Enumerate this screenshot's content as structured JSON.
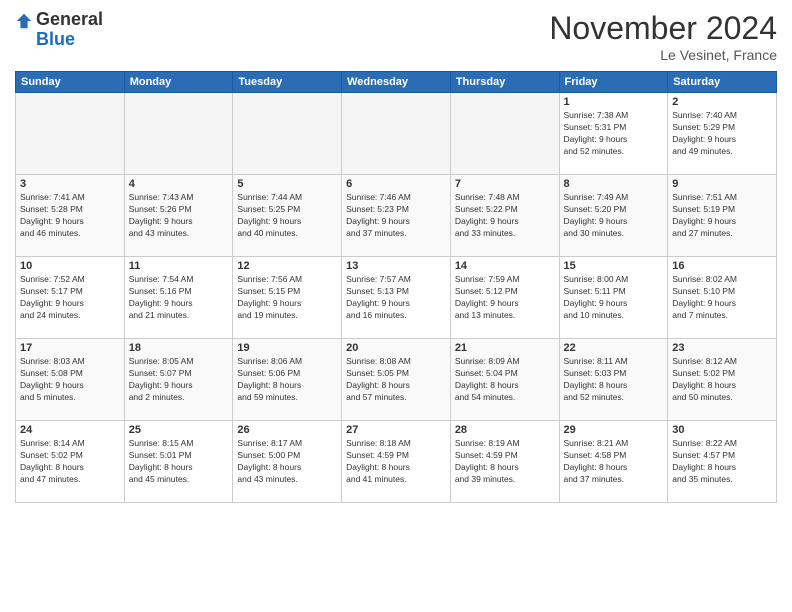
{
  "header": {
    "logo_general": "General",
    "logo_blue": "Blue",
    "month_title": "November 2024",
    "location": "Le Vesinet, France"
  },
  "weekdays": [
    "Sunday",
    "Monday",
    "Tuesday",
    "Wednesday",
    "Thursday",
    "Friday",
    "Saturday"
  ],
  "weeks": [
    [
      {
        "day": "",
        "info": ""
      },
      {
        "day": "",
        "info": ""
      },
      {
        "day": "",
        "info": ""
      },
      {
        "day": "",
        "info": ""
      },
      {
        "day": "",
        "info": ""
      },
      {
        "day": "1",
        "info": "Sunrise: 7:38 AM\nSunset: 5:31 PM\nDaylight: 9 hours\nand 52 minutes."
      },
      {
        "day": "2",
        "info": "Sunrise: 7:40 AM\nSunset: 5:29 PM\nDaylight: 9 hours\nand 49 minutes."
      }
    ],
    [
      {
        "day": "3",
        "info": "Sunrise: 7:41 AM\nSunset: 5:28 PM\nDaylight: 9 hours\nand 46 minutes."
      },
      {
        "day": "4",
        "info": "Sunrise: 7:43 AM\nSunset: 5:26 PM\nDaylight: 9 hours\nand 43 minutes."
      },
      {
        "day": "5",
        "info": "Sunrise: 7:44 AM\nSunset: 5:25 PM\nDaylight: 9 hours\nand 40 minutes."
      },
      {
        "day": "6",
        "info": "Sunrise: 7:46 AM\nSunset: 5:23 PM\nDaylight: 9 hours\nand 37 minutes."
      },
      {
        "day": "7",
        "info": "Sunrise: 7:48 AM\nSunset: 5:22 PM\nDaylight: 9 hours\nand 33 minutes."
      },
      {
        "day": "8",
        "info": "Sunrise: 7:49 AM\nSunset: 5:20 PM\nDaylight: 9 hours\nand 30 minutes."
      },
      {
        "day": "9",
        "info": "Sunrise: 7:51 AM\nSunset: 5:19 PM\nDaylight: 9 hours\nand 27 minutes."
      }
    ],
    [
      {
        "day": "10",
        "info": "Sunrise: 7:52 AM\nSunset: 5:17 PM\nDaylight: 9 hours\nand 24 minutes."
      },
      {
        "day": "11",
        "info": "Sunrise: 7:54 AM\nSunset: 5:16 PM\nDaylight: 9 hours\nand 21 minutes."
      },
      {
        "day": "12",
        "info": "Sunrise: 7:56 AM\nSunset: 5:15 PM\nDaylight: 9 hours\nand 19 minutes."
      },
      {
        "day": "13",
        "info": "Sunrise: 7:57 AM\nSunset: 5:13 PM\nDaylight: 9 hours\nand 16 minutes."
      },
      {
        "day": "14",
        "info": "Sunrise: 7:59 AM\nSunset: 5:12 PM\nDaylight: 9 hours\nand 13 minutes."
      },
      {
        "day": "15",
        "info": "Sunrise: 8:00 AM\nSunset: 5:11 PM\nDaylight: 9 hours\nand 10 minutes."
      },
      {
        "day": "16",
        "info": "Sunrise: 8:02 AM\nSunset: 5:10 PM\nDaylight: 9 hours\nand 7 minutes."
      }
    ],
    [
      {
        "day": "17",
        "info": "Sunrise: 8:03 AM\nSunset: 5:08 PM\nDaylight: 9 hours\nand 5 minutes."
      },
      {
        "day": "18",
        "info": "Sunrise: 8:05 AM\nSunset: 5:07 PM\nDaylight: 9 hours\nand 2 minutes."
      },
      {
        "day": "19",
        "info": "Sunrise: 8:06 AM\nSunset: 5:06 PM\nDaylight: 8 hours\nand 59 minutes."
      },
      {
        "day": "20",
        "info": "Sunrise: 8:08 AM\nSunset: 5:05 PM\nDaylight: 8 hours\nand 57 minutes."
      },
      {
        "day": "21",
        "info": "Sunrise: 8:09 AM\nSunset: 5:04 PM\nDaylight: 8 hours\nand 54 minutes."
      },
      {
        "day": "22",
        "info": "Sunrise: 8:11 AM\nSunset: 5:03 PM\nDaylight: 8 hours\nand 52 minutes."
      },
      {
        "day": "23",
        "info": "Sunrise: 8:12 AM\nSunset: 5:02 PM\nDaylight: 8 hours\nand 50 minutes."
      }
    ],
    [
      {
        "day": "24",
        "info": "Sunrise: 8:14 AM\nSunset: 5:02 PM\nDaylight: 8 hours\nand 47 minutes."
      },
      {
        "day": "25",
        "info": "Sunrise: 8:15 AM\nSunset: 5:01 PM\nDaylight: 8 hours\nand 45 minutes."
      },
      {
        "day": "26",
        "info": "Sunrise: 8:17 AM\nSunset: 5:00 PM\nDaylight: 8 hours\nand 43 minutes."
      },
      {
        "day": "27",
        "info": "Sunrise: 8:18 AM\nSunset: 4:59 PM\nDaylight: 8 hours\nand 41 minutes."
      },
      {
        "day": "28",
        "info": "Sunrise: 8:19 AM\nSunset: 4:59 PM\nDaylight: 8 hours\nand 39 minutes."
      },
      {
        "day": "29",
        "info": "Sunrise: 8:21 AM\nSunset: 4:58 PM\nDaylight: 8 hours\nand 37 minutes."
      },
      {
        "day": "30",
        "info": "Sunrise: 8:22 AM\nSunset: 4:57 PM\nDaylight: 8 hours\nand 35 minutes."
      }
    ]
  ]
}
